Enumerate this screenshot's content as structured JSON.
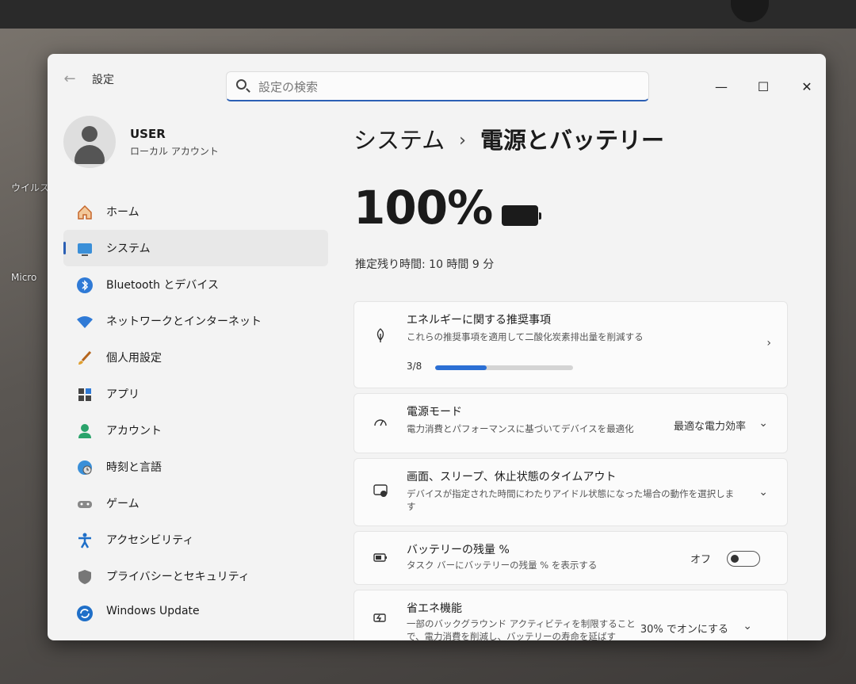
{
  "desktop": {
    "icon1_label": "ウイルス",
    "icon2_label": "Micro"
  },
  "window": {
    "title": "設定",
    "search_placeholder": "設定の検索",
    "controls": {
      "minimize": "—",
      "maximize": "☐",
      "close": "✕"
    }
  },
  "profile": {
    "name": "USER",
    "account_type": "ローカル アカウント"
  },
  "nav": {
    "items": [
      {
        "label": "ホーム",
        "icon": "home-icon",
        "active": false
      },
      {
        "label": "システム",
        "icon": "system-icon",
        "active": true
      },
      {
        "label": "Bluetooth とデバイス",
        "icon": "bluetooth-icon",
        "active": false
      },
      {
        "label": "ネットワークとインターネット",
        "icon": "wifi-icon",
        "active": false
      },
      {
        "label": "個人用設定",
        "icon": "brush-icon",
        "active": false
      },
      {
        "label": "アプリ",
        "icon": "apps-icon",
        "active": false
      },
      {
        "label": "アカウント",
        "icon": "account-icon",
        "active": false
      },
      {
        "label": "時刻と言語",
        "icon": "globe-clock-icon",
        "active": false
      },
      {
        "label": "ゲーム",
        "icon": "gamepad-icon",
        "active": false
      },
      {
        "label": "アクセシビリティ",
        "icon": "accessibility-icon",
        "active": false
      },
      {
        "label": "プライバシーとセキュリティ",
        "icon": "shield-icon",
        "active": false
      },
      {
        "label": "Windows Update",
        "icon": "windows-update-icon",
        "active": false
      }
    ]
  },
  "main": {
    "breadcrumb_parent": "システム",
    "breadcrumb_sep": "›",
    "breadcrumb_current": "電源とバッテリー",
    "battery_percent": "100%",
    "remaining_time": "推定残り時間: 10 時間 9 分",
    "energy": {
      "title": "エネルギーに関する推奨事項",
      "description": "これらの推奨事項を適用して二酸化炭素排出量を削減する",
      "progress_label": "3/8",
      "progress_fraction": 0.375
    },
    "power_mode": {
      "title": "電源モード",
      "description": "電力消費とパフォーマンスに基づいてデバイスを最適化",
      "value": "最適な電力効率"
    },
    "screen_sleep": {
      "title": "画面、スリープ、休止状態のタイムアウト",
      "description": "デバイスが指定された時間にわたりアイドル状態になった場合の動作を選択します"
    },
    "battery_percentage": {
      "title": "バッテリーの残量 %",
      "description": "タスク バーにバッテリーの残量 % を表示する",
      "toggle_label": "オフ"
    },
    "energy_saver": {
      "title": "省エネ機能",
      "description": "一部のバックグラウンド アクティビティを制限することで、電力消費を削減し、バッテリーの寿命を延ばす",
      "value": "30% でオンにする"
    }
  },
  "colors": {
    "accent": "#2b5fb4",
    "progress": "#2b6fd4"
  }
}
